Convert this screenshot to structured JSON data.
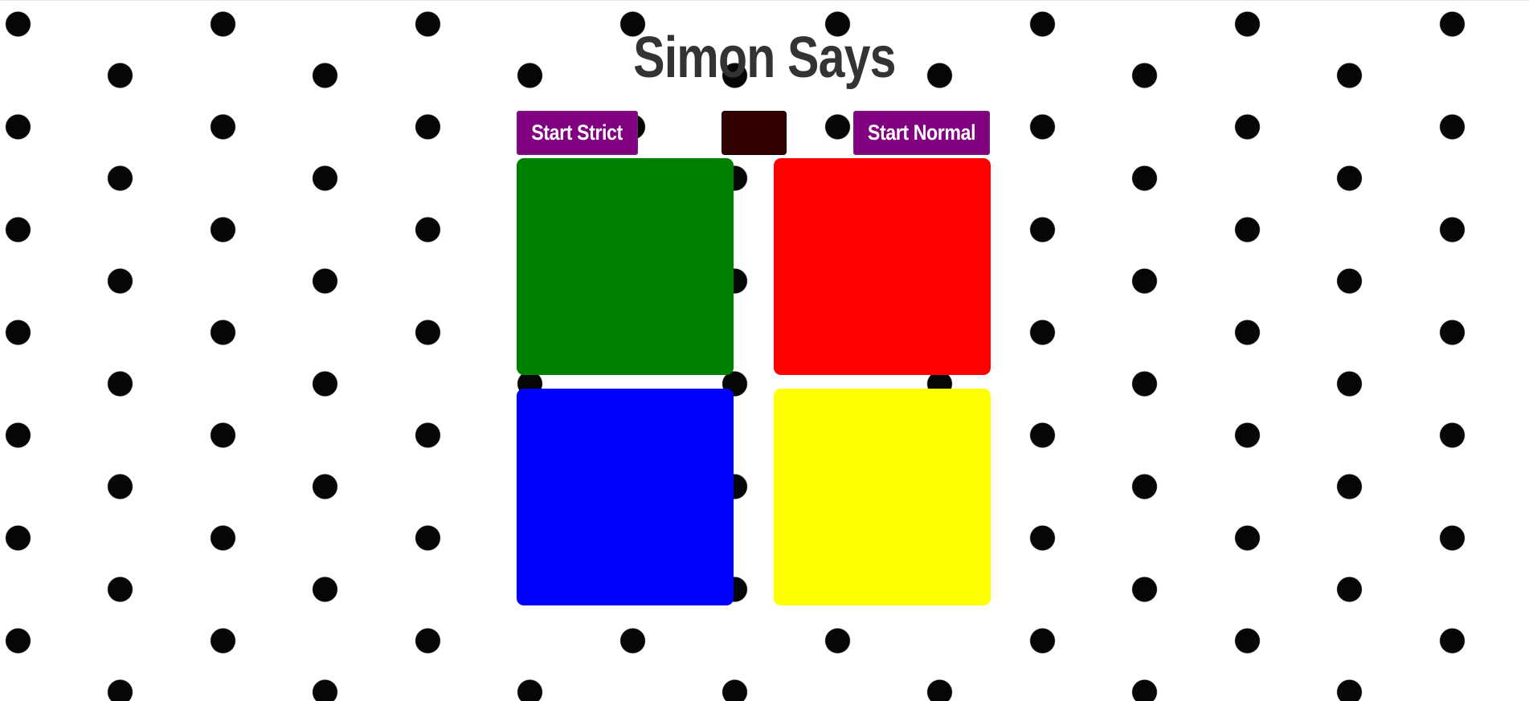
{
  "title": "Simon Says",
  "controls": {
    "start_strict_label": "Start Strict",
    "start_normal_label": "Start Normal",
    "count_display": ""
  },
  "pads": [
    {
      "color_name": "green",
      "color": "#008000"
    },
    {
      "color_name": "red",
      "color": "#ff0000"
    },
    {
      "color_name": "blue",
      "color": "#0000ff"
    },
    {
      "color_name": "yellow",
      "color": "#ffff00"
    }
  ],
  "colors": {
    "background": "#ffffff",
    "polka_dot": "#050706",
    "title_text": "#333333",
    "button_bg": "#800080",
    "button_text": "#ffffff",
    "display_bg": "#330000"
  }
}
